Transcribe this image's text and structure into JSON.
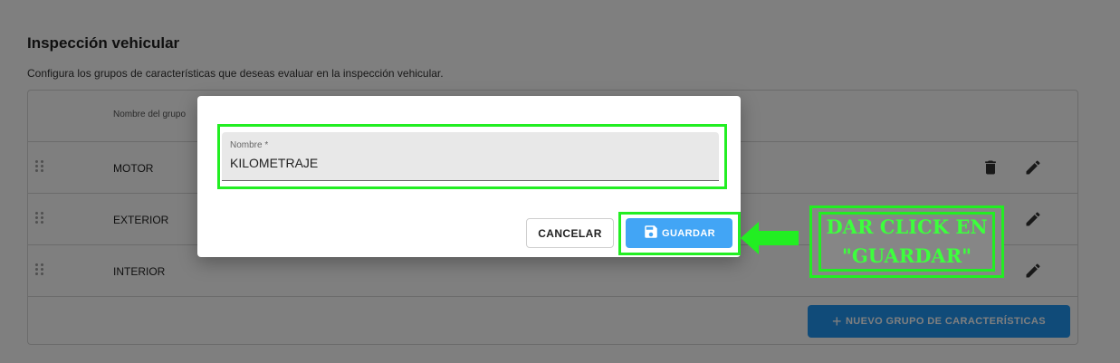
{
  "page": {
    "title": "Inspección vehicular",
    "subtitle": "Configura los grupos de características que deseas evaluar en la inspección vehicular."
  },
  "table": {
    "column_name": "Nombre del grupo",
    "rows": [
      {
        "name": "MOTOR"
      },
      {
        "name": "EXTERIOR"
      },
      {
        "name": "INTERIOR"
      }
    ],
    "row_actions": {
      "delete_icon": "trash-icon",
      "edit_icon": "pencil-icon"
    },
    "drag_icon": "drag-handle-icon",
    "add_button_label": "NUEVO GRUPO DE CARACTERÍSTICAS",
    "add_button_icon": "plus-icon"
  },
  "dialog": {
    "field_label": "Nombre *",
    "field_value": "KILOMETRAJE",
    "cancel_label": "CANCELAR",
    "save_label": "GUARDAR",
    "save_icon": "floppy-disk-icon"
  },
  "annotation": {
    "text": "DAR CLICK EN\n\"GUARDAR\"",
    "color": "#22ee22"
  },
  "colors": {
    "primary": "#2196f3",
    "primary_light": "#42a5f5",
    "highlight": "#22ee22"
  }
}
